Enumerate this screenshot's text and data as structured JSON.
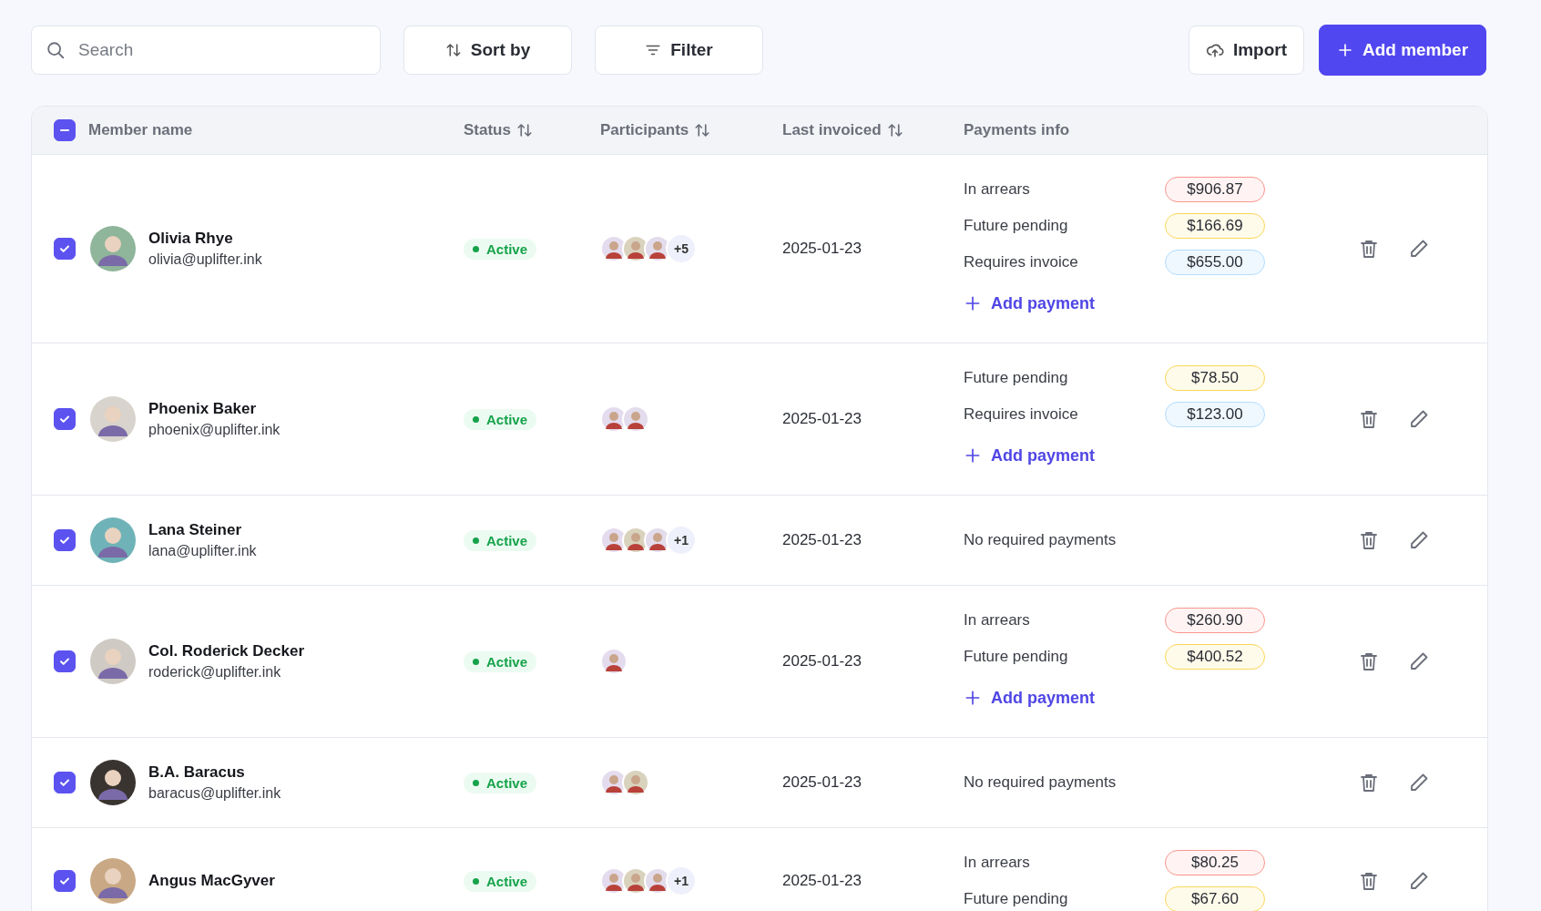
{
  "toolbar": {
    "search": {
      "placeholder": "Search"
    },
    "sort_button": "Sort by",
    "filter_button": "Filter",
    "import_button": "Import",
    "add_button": "Add member"
  },
  "table": {
    "header_checkbox": {
      "indeterminate": true
    },
    "columns": [
      {
        "label": "Member name",
        "sortable": false
      },
      {
        "label": "Status",
        "sortable": true
      },
      {
        "label": "Participants",
        "sortable": true
      },
      {
        "label": "Last invoiced",
        "sortable": true
      },
      {
        "label": "Payments info",
        "sortable": false
      }
    ],
    "rows": [
      {
        "checked": true,
        "name": "Olivia Rhye",
        "email": "olivia@uplifter.ink",
        "status": {
          "label": "Active",
          "kind": "active"
        },
        "participants": [
          {
            "color": "#e4dcee"
          },
          {
            "color": "#d9d2bd"
          },
          {
            "color": "#e3dcec"
          }
        ],
        "more": "+5",
        "last_invoiced": "2025-01-23",
        "payments": [
          {
            "label": "In arrears",
            "amount": "$906.87",
            "kind": "arrears"
          },
          {
            "label": "Future pending",
            "amount": "$166.69",
            "kind": "pending"
          },
          {
            "label": "Requires invoice",
            "amount": "$655.00",
            "kind": "invoice"
          }
        ],
        "add_payment": "Add payment"
      },
      {
        "checked": true,
        "name": "Phoenix Baker",
        "email": "phoenix@uplifter.ink",
        "status": {
          "label": "Active",
          "kind": "active"
        },
        "participants": [
          {
            "color": "#e4dcee"
          },
          {
            "color": "#e3dcec"
          }
        ],
        "last_invoiced": "2025-01-23",
        "payments": [
          {
            "label": "Future pending",
            "amount": "$78.50",
            "kind": "pending"
          },
          {
            "label": "Requires invoice",
            "amount": "$123.00",
            "kind": "invoice"
          }
        ],
        "add_payment": "Add payment"
      },
      {
        "checked": true,
        "name": "Lana Steiner",
        "email": "lana@uplifter.ink",
        "status": {
          "label": "Active",
          "kind": "active"
        },
        "participants": [
          {
            "color": "#e4dcee"
          },
          {
            "color": "#d9d2bd"
          },
          {
            "color": "#e3dcec"
          }
        ],
        "more": "+1",
        "last_invoiced": "2025-01-23",
        "no_payments": "No required payments"
      },
      {
        "checked": true,
        "name": "Col. Roderick Decker",
        "email": "roderick@uplifter.ink",
        "status": {
          "label": "Active",
          "kind": "active"
        },
        "participants": [
          {
            "color": "#e4dcee"
          }
        ],
        "last_invoiced": "2025-01-23",
        "payments": [
          {
            "label": "In arrears",
            "amount": "$260.90",
            "kind": "arrears"
          },
          {
            "label": "Future pending",
            "amount": "$400.52",
            "kind": "pending"
          }
        ],
        "add_payment": "Add payment"
      },
      {
        "checked": true,
        "name": "B.A. Baracus",
        "email": "baracus@uplifter.ink",
        "status": {
          "label": "Active",
          "kind": "active"
        },
        "participants": [
          {
            "color": "#e4dcee"
          },
          {
            "color": "#d9d2bd"
          }
        ],
        "last_invoiced": "2025-01-23",
        "no_payments": "No required payments"
      },
      {
        "checked": true,
        "name": "Angus MacGyver",
        "status": {
          "label": "Active",
          "kind": "active"
        },
        "participants": [
          {
            "color": "#e4dcee"
          },
          {
            "color": "#d9d2bd"
          },
          {
            "color": "#e3dcec"
          }
        ],
        "more": "+1",
        "last_invoiced": "2025-01-23",
        "payments": [
          {
            "label": "In arrears",
            "amount": "$80.25",
            "kind": "arrears"
          },
          {
            "label": "Future pending",
            "amount": "$67.60",
            "kind": "pending"
          }
        ]
      }
    ]
  }
}
